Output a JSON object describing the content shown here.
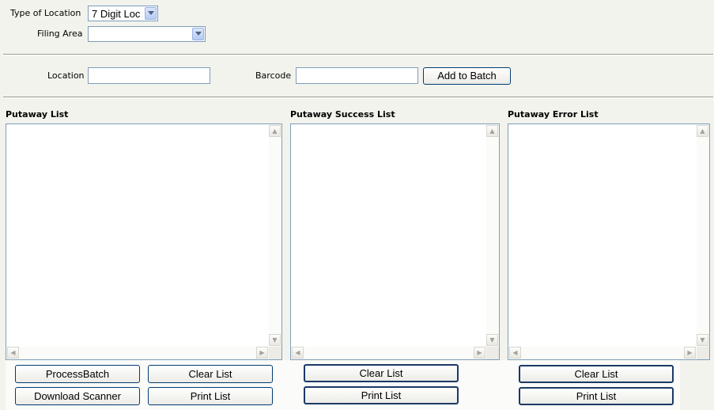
{
  "filters": {
    "type_of_location_label": "Type of Location",
    "type_of_location_value": "7 Digit Loc",
    "filing_area_label": "Filing Area",
    "filing_area_value": ""
  },
  "entry": {
    "location_label": "Location",
    "location_value": "",
    "barcode_label": "Barcode",
    "barcode_value": "",
    "add_to_batch_label": "Add to Batch"
  },
  "lists": {
    "putaway": {
      "title": "Putaway List",
      "items": []
    },
    "success": {
      "title": "Putaway Success List",
      "items": []
    },
    "error": {
      "title": "Putaway Error List",
      "items": []
    }
  },
  "buttons": {
    "process_batch": "ProcessBatch",
    "clear_list": "Clear List",
    "download_scanner": "Download Scanner",
    "print_list": "Print List"
  },
  "icons": {
    "dropdown": "chevron-down-icon",
    "scroll_up": "arrow-up-icon",
    "scroll_down": "arrow-down-icon",
    "scroll_left": "arrow-left-icon",
    "scroll_right": "arrow-right-icon"
  }
}
